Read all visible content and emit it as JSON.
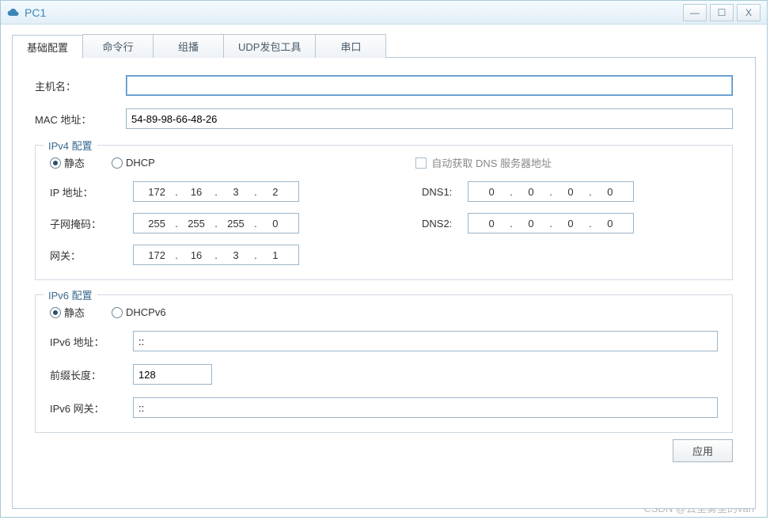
{
  "window": {
    "title": "PC1"
  },
  "tabs": {
    "t0": "基础配置",
    "t1": "命令行",
    "t2": "组播",
    "t3": "UDP发包工具",
    "t4": "串口"
  },
  "basic": {
    "hostname_label": "主机名：",
    "hostname_value": "",
    "mac_label": "MAC 地址：",
    "mac_value": "54-89-98-66-48-26"
  },
  "ipv4": {
    "legend": "IPv4 配置",
    "static_label": "静态",
    "dhcp_label": "DHCP",
    "autodns_label": "自动获取 DNS 服务器地址",
    "ip_label": "IP 地址：",
    "ip": {
      "o1": "172",
      "o2": "16",
      "o3": "3",
      "o4": "2"
    },
    "mask_label": "子网掩码：",
    "mask": {
      "o1": "255",
      "o2": "255",
      "o3": "255",
      "o4": "0"
    },
    "gw_label": "网关：",
    "gw": {
      "o1": "172",
      "o2": "16",
      "o3": "3",
      "o4": "1"
    },
    "dns1_label": "DNS1:",
    "dns1": {
      "o1": "0",
      "o2": "0",
      "o3": "0",
      "o4": "0"
    },
    "dns2_label": "DNS2:",
    "dns2": {
      "o1": "0",
      "o2": "0",
      "o3": "0",
      "o4": "0"
    }
  },
  "ipv6": {
    "legend": "IPv6 配置",
    "static_label": "静态",
    "dhcp_label": "DHCPv6",
    "addr_label": "IPv6 地址：",
    "addr_value": "::",
    "prefix_label": "前缀长度：",
    "prefix_value": "128",
    "gw_label": "IPv6 网关：",
    "gw_value": "::"
  },
  "apply_label": "应用",
  "watermark": "CSDN @云里雾里的van"
}
